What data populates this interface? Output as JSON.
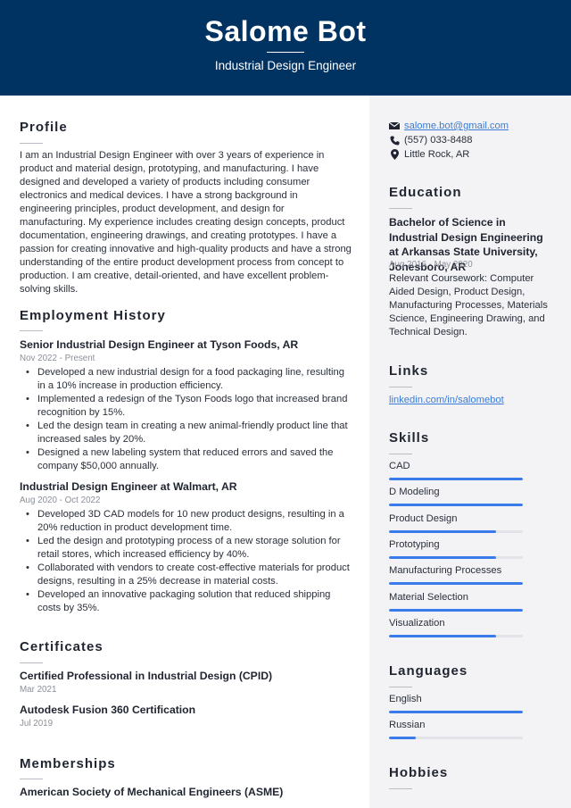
{
  "header": {
    "name": "Salome Bot",
    "title": "Industrial Design Engineer"
  },
  "profile": {
    "heading": "Profile",
    "text": "I am an Industrial Design Engineer with over 3 years of experience in product and material design, prototyping, and manufacturing. I have designed and developed a variety of products including consumer electronics and medical devices. I have a strong background in engineering principles, product development, and design for manufacturing. My experience includes creating design concepts, product documentation, engineering drawings, and creating prototypes. I have a passion for creating innovative and high-quality products and have a strong understanding of the entire product development process from concept to production. I am creative, detail-oriented, and have excellent problem-solving skills."
  },
  "employment": {
    "heading": "Employment History",
    "jobs": [
      {
        "title": "Senior Industrial Design Engineer at Tyson Foods, AR",
        "dates": "Nov 2022 - Present",
        "bullets": [
          "Developed a new industrial design for a food packaging line, resulting in a 10% increase in production efficiency.",
          "Implemented a redesign of the Tyson Foods logo that increased brand recognition by 15%.",
          "Led the design team in creating a new animal-friendly product line that increased sales by 20%.",
          "Designed a new labeling system that reduced errors and saved the company $50,000 annually."
        ]
      },
      {
        "title": "Industrial Design Engineer at Walmart, AR",
        "dates": "Aug 2020 - Oct 2022",
        "bullets": [
          "Developed 3D CAD models for 10 new product designs, resulting in a 20% reduction in product development time.",
          "Led the design and prototyping process of a new storage solution for retail stores, which increased efficiency by 40%.",
          "Collaborated with vendors to create cost-effective materials for product designs, resulting in a 25% decrease in material costs.",
          "Developed an innovative packaging solution that reduced shipping costs by 35%."
        ]
      }
    ]
  },
  "certificates": {
    "heading": "Certificates",
    "items": [
      {
        "title": "Certified Professional in Industrial Design (CPID)",
        "date": "Mar 2021"
      },
      {
        "title": "Autodesk Fusion 360 Certification",
        "date": "Jul 2019"
      }
    ]
  },
  "memberships": {
    "heading": "Memberships",
    "items": [
      {
        "title": "American Society of Mechanical Engineers (ASME)"
      }
    ]
  },
  "contact": {
    "email": "salome.bot@gmail.com",
    "phone": "(557) 033-8488",
    "location": "Little Rock, AR",
    "icons": {
      "email": "envelope-icon",
      "phone": "phone-icon",
      "location": "map-pin-icon"
    }
  },
  "education": {
    "heading": "Education",
    "degree": "Bachelor of Science in Industrial Design Engineering at Arkansas State University, Jonesboro, AR",
    "dates": "Aug 2016 - May 2020",
    "description": "Relevant Coursework: Computer Aided Design, Product Design, Manufacturing Processes, Materials Science, Engineering Drawing, and Technical Design."
  },
  "links": {
    "heading": "Links",
    "items": [
      {
        "label": "linkedin.com/in/salomebot"
      }
    ]
  },
  "skills": {
    "heading": "Skills",
    "items": [
      {
        "label": "CAD",
        "level": 1.0
      },
      {
        "label": "D Modeling",
        "level": 1.0
      },
      {
        "label": "Product Design",
        "level": 0.8
      },
      {
        "label": "Prototyping",
        "level": 0.8
      },
      {
        "label": "Manufacturing Processes",
        "level": 1.0
      },
      {
        "label": "Material Selection",
        "level": 1.0
      },
      {
        "label": "Visualization",
        "level": 0.8
      }
    ]
  },
  "languages": {
    "heading": "Languages",
    "items": [
      {
        "label": "English",
        "level": 1.0
      },
      {
        "label": "Russian",
        "level": 0.2
      }
    ]
  },
  "hobbies": {
    "heading": "Hobbies"
  },
  "colors": {
    "header_bg": "#003262",
    "sidebar_bg": "#f3f3f6",
    "accent_bar": "#3a7bec",
    "link": "#3a7bd5"
  }
}
